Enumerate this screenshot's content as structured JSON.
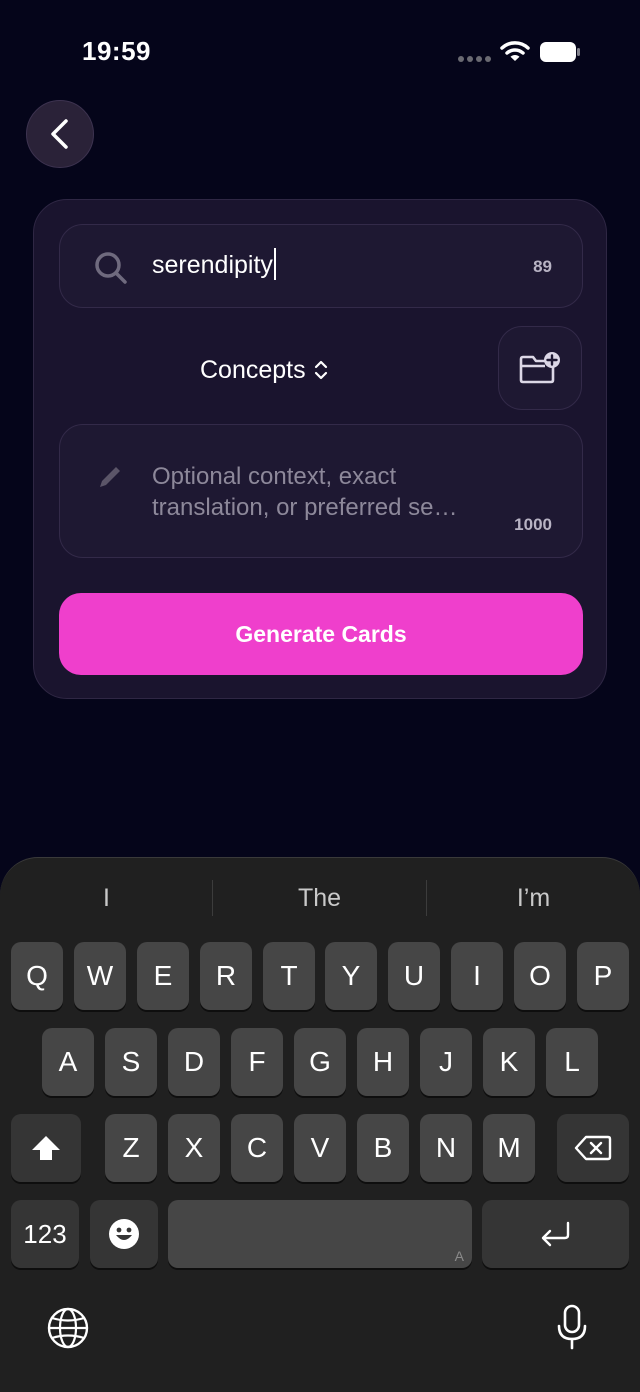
{
  "status_bar": {
    "time": "19:59"
  },
  "search": {
    "value": "serendipity",
    "count": "89"
  },
  "category": {
    "label": "Concepts"
  },
  "context": {
    "placeholder": "Optional context, exact translation, or preferred se…",
    "count": "1000"
  },
  "generate": {
    "label": "Generate Cards"
  },
  "keyboard": {
    "suggestions": [
      "I",
      "The",
      "I’m"
    ],
    "row1": [
      "Q",
      "W",
      "E",
      "R",
      "T",
      "Y",
      "U",
      "I",
      "O",
      "P"
    ],
    "row2": [
      "A",
      "S",
      "D",
      "F",
      "G",
      "H",
      "J",
      "K",
      "L"
    ],
    "row3": [
      "Z",
      "X",
      "C",
      "V",
      "B",
      "N",
      "M"
    ],
    "numbers_label": "123",
    "space_hint": "A"
  },
  "colors": {
    "accent": "#ef3fcc",
    "background": "#05051a",
    "card": "#1a142e"
  },
  "icons": [
    "chevron-left-icon",
    "search-icon",
    "folder-plus-icon",
    "pencil-icon",
    "shift-icon",
    "delete-icon",
    "emoji-icon",
    "return-icon",
    "globe-icon",
    "microphone-icon"
  ]
}
